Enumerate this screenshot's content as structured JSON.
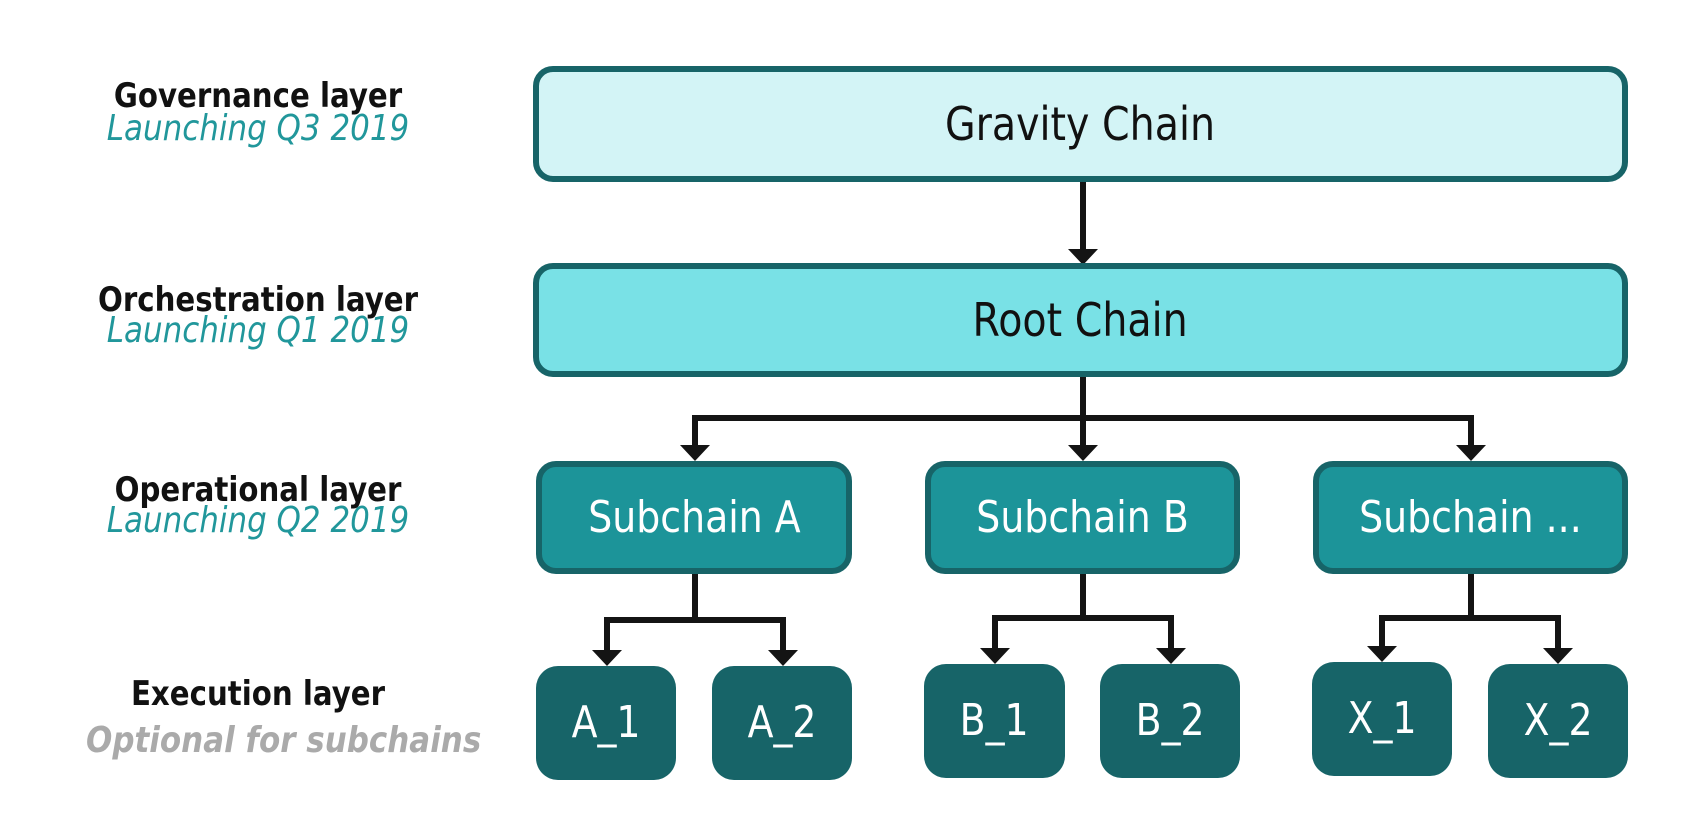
{
  "layers": [
    {
      "title": "Governance layer",
      "subtitle": "Launching Q3 2019",
      "subtitle_style": "teal"
    },
    {
      "title": "Orchestration layer",
      "subtitle": "Launching Q1 2019",
      "subtitle_style": "teal"
    },
    {
      "title": "Operational layer",
      "subtitle": "Launching Q2 2019",
      "subtitle_style": "teal"
    },
    {
      "title": "Execution layer",
      "subtitle": "Optional for subchains",
      "subtitle_style": "grey"
    }
  ],
  "nodes": {
    "gravity": {
      "label": "Gravity Chain"
    },
    "root": {
      "label": "Root Chain"
    },
    "subchains": [
      {
        "label": "Subchain A",
        "children": [
          "A_1",
          "A_2"
        ]
      },
      {
        "label": "Subchain B",
        "children": [
          "B_1",
          "B_2"
        ]
      },
      {
        "label": "Subchain ...",
        "children": [
          "X_1",
          "X_2"
        ]
      }
    ]
  },
  "edges": [
    {
      "from": "Gravity Chain",
      "to": "Root Chain"
    },
    {
      "from": "Root Chain",
      "to": "Subchain A"
    },
    {
      "from": "Root Chain",
      "to": "Subchain B"
    },
    {
      "from": "Root Chain",
      "to": "Subchain ..."
    },
    {
      "from": "Subchain A",
      "to": "A_1"
    },
    {
      "from": "Subchain A",
      "to": "A_2"
    },
    {
      "from": "Subchain B",
      "to": "B_1"
    },
    {
      "from": "Subchain B",
      "to": "B_2"
    },
    {
      "from": "Subchain ...",
      "to": "X_1"
    },
    {
      "from": "Subchain ...",
      "to": "X_2"
    }
  ],
  "colors": {
    "gravity_fill": "#d3f4f6",
    "root_fill": "#79e1e6",
    "subchain_fill": "#1c9499",
    "leaf_fill": "#176468",
    "border": "#176468",
    "launch_text": "#21979b",
    "optional_text": "#aaaaaa",
    "connector": "#141414"
  }
}
